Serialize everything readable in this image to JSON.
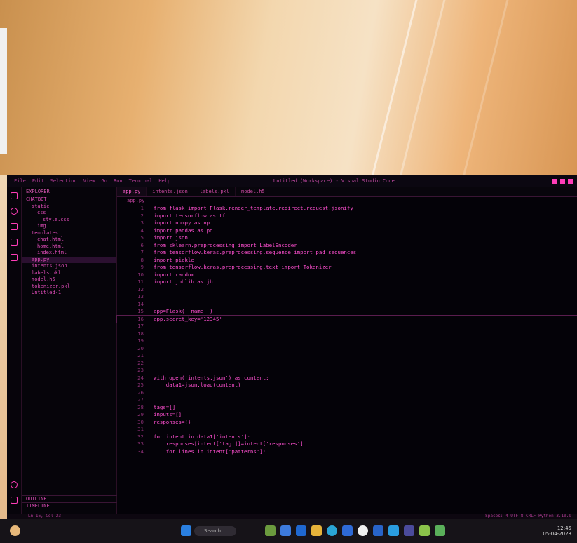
{
  "window": {
    "title": "Untitled (Workspace) - Visual Studio Code",
    "menu": [
      "File",
      "Edit",
      "Selection",
      "View",
      "Go",
      "Run",
      "Terminal",
      "Help"
    ]
  },
  "explorer": {
    "header": "EXPLORER",
    "tree": [
      {
        "label": "CHATBOT",
        "indent": 0
      },
      {
        "label": "static",
        "indent": 1
      },
      {
        "label": "css",
        "indent": 2
      },
      {
        "label": "style.css",
        "indent": 3
      },
      {
        "label": "img",
        "indent": 2
      },
      {
        "label": "templates",
        "indent": 1
      },
      {
        "label": "chat.html",
        "indent": 2
      },
      {
        "label": "home.html",
        "indent": 2
      },
      {
        "label": "index.html",
        "indent": 2
      },
      {
        "label": "app.py",
        "indent": 1,
        "selected": true
      },
      {
        "label": "intents.json",
        "indent": 1
      },
      {
        "label": "labels.pkl",
        "indent": 1
      },
      {
        "label": "model.h5",
        "indent": 1
      },
      {
        "label": "tokenizer.pkl",
        "indent": 1
      },
      {
        "label": "Untitled-1",
        "indent": 1
      }
    ],
    "outline": "OUTLINE",
    "timeline": "TIMELINE"
  },
  "tabs": [
    {
      "label": "app.py",
      "active": true
    },
    {
      "label": "intents.json",
      "active": false
    },
    {
      "label": "labels.pkl",
      "active": false
    },
    {
      "label": "model.h5",
      "active": false
    }
  ],
  "breadcrumb": "app.py",
  "code": [
    {
      "n": "1",
      "t": "from flask import Flask,render_template,redirect,request,jsonify"
    },
    {
      "n": "2",
      "t": "import tensorflow as tf"
    },
    {
      "n": "3",
      "t": "import numpy as np"
    },
    {
      "n": "4",
      "t": "import pandas as pd"
    },
    {
      "n": "5",
      "t": "import json"
    },
    {
      "n": "6",
      "t": "from sklearn.preprocessing import LabelEncoder"
    },
    {
      "n": "7",
      "t": "from tensorflow.keras.preprocessing.sequence import pad_sequences"
    },
    {
      "n": "8",
      "t": "import pickle"
    },
    {
      "n": "9",
      "t": "from tensorflow.keras.preprocessing.text import Tokenizer"
    },
    {
      "n": "10",
      "t": "import random"
    },
    {
      "n": "11",
      "t": "import joblib as jb"
    },
    {
      "n": "12",
      "t": ""
    },
    {
      "n": "13",
      "t": ""
    },
    {
      "n": "14",
      "t": ""
    },
    {
      "n": "15",
      "t": "app=Flask(__name__)"
    },
    {
      "n": "16",
      "t": "app.secret_key='12345'",
      "cur": true
    },
    {
      "n": "17",
      "t": ""
    },
    {
      "n": "18",
      "t": ""
    },
    {
      "n": "19",
      "t": ""
    },
    {
      "n": "20",
      "t": ""
    },
    {
      "n": "21",
      "t": ""
    },
    {
      "n": "22",
      "t": ""
    },
    {
      "n": "23",
      "t": ""
    },
    {
      "n": "24",
      "t": "with open('intents.json') as content:"
    },
    {
      "n": "25",
      "t": "    data1=json.load(content)"
    },
    {
      "n": "26",
      "t": ""
    },
    {
      "n": "27",
      "t": ""
    },
    {
      "n": "28",
      "t": "tags=[]"
    },
    {
      "n": "29",
      "t": "inputs=[]"
    },
    {
      "n": "30",
      "t": "responses={}"
    },
    {
      "n": "31",
      "t": ""
    },
    {
      "n": "32",
      "t": "for intent in data1['intents']:"
    },
    {
      "n": "33",
      "t": "    responses[intent['tag']]=intent['responses']"
    },
    {
      "n": "34",
      "t": "    for lines in intent['patterns']:"
    }
  ],
  "status": {
    "left": "Ln 16, Col 23",
    "right": "Spaces: 4   UTF-8   CRLF   Python 3.10.9"
  },
  "taskbar": {
    "search": "Search",
    "time": "12:45",
    "date": "05-04-2023"
  },
  "colors": {
    "accent": "#ff3db8",
    "editor_bg": "#040208"
  }
}
